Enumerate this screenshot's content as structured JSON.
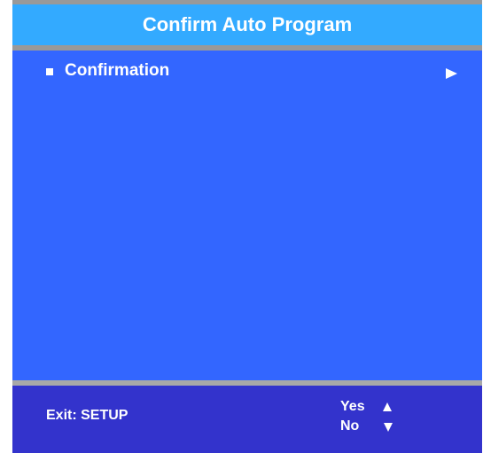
{
  "header": {
    "title": "Confirm Auto Program"
  },
  "menu": {
    "items": [
      {
        "label": "Confirmation"
      }
    ]
  },
  "footer": {
    "exit_label": "Exit: SETUP",
    "yes_label": "Yes",
    "no_label": "No"
  },
  "icons": {
    "bullet": "square-bullet-icon",
    "submenu": "arrow-right-icon",
    "up": "arrow-up-icon",
    "down": "arrow-down-icon"
  },
  "colors": {
    "title_bar": "#33aaff",
    "menu_background": "#3366ff",
    "footer_background": "#3333cc",
    "divider": "#a8a8a8",
    "text": "#ffffff"
  }
}
